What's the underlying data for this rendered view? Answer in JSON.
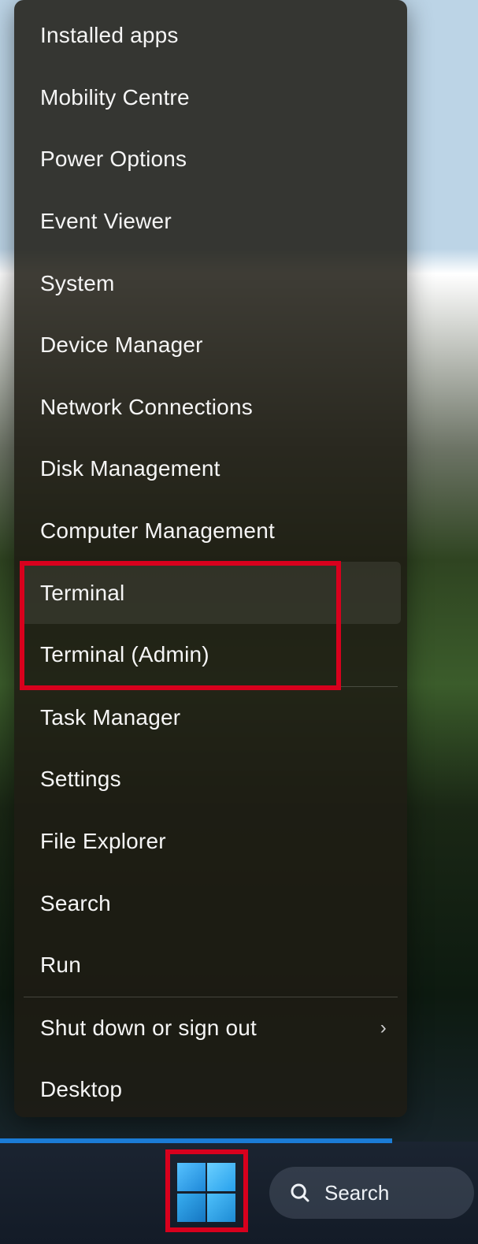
{
  "menu": {
    "sections": [
      [
        {
          "label": "Installed apps",
          "name": "menu-installed-apps",
          "hovered": false,
          "submenu": false
        },
        {
          "label": "Mobility Centre",
          "name": "menu-mobility-centre",
          "hovered": false,
          "submenu": false
        },
        {
          "label": "Power Options",
          "name": "menu-power-options",
          "hovered": false,
          "submenu": false
        },
        {
          "label": "Event Viewer",
          "name": "menu-event-viewer",
          "hovered": false,
          "submenu": false
        },
        {
          "label": "System",
          "name": "menu-system",
          "hovered": false,
          "submenu": false
        },
        {
          "label": "Device Manager",
          "name": "menu-device-manager",
          "hovered": false,
          "submenu": false
        },
        {
          "label": "Network Connections",
          "name": "menu-network-connections",
          "hovered": false,
          "submenu": false
        },
        {
          "label": "Disk Management",
          "name": "menu-disk-management",
          "hovered": false,
          "submenu": false
        },
        {
          "label": "Computer Management",
          "name": "menu-computer-management",
          "hovered": false,
          "submenu": false
        },
        {
          "label": "Terminal",
          "name": "menu-terminal",
          "hovered": true,
          "submenu": false
        },
        {
          "label": "Terminal (Admin)",
          "name": "menu-terminal-admin",
          "hovered": false,
          "submenu": false
        }
      ],
      [
        {
          "label": "Task Manager",
          "name": "menu-task-manager",
          "hovered": false,
          "submenu": false
        },
        {
          "label": "Settings",
          "name": "menu-settings",
          "hovered": false,
          "submenu": false
        },
        {
          "label": "File Explorer",
          "name": "menu-file-explorer",
          "hovered": false,
          "submenu": false
        },
        {
          "label": "Search",
          "name": "menu-search",
          "hovered": false,
          "submenu": false
        },
        {
          "label": "Run",
          "name": "menu-run",
          "hovered": false,
          "submenu": false
        }
      ],
      [
        {
          "label": "Shut down or sign out",
          "name": "menu-shutdown",
          "hovered": false,
          "submenu": true
        },
        {
          "label": "Desktop",
          "name": "menu-desktop",
          "hovered": false,
          "submenu": false
        }
      ]
    ]
  },
  "taskbar": {
    "search_label": "Search"
  }
}
